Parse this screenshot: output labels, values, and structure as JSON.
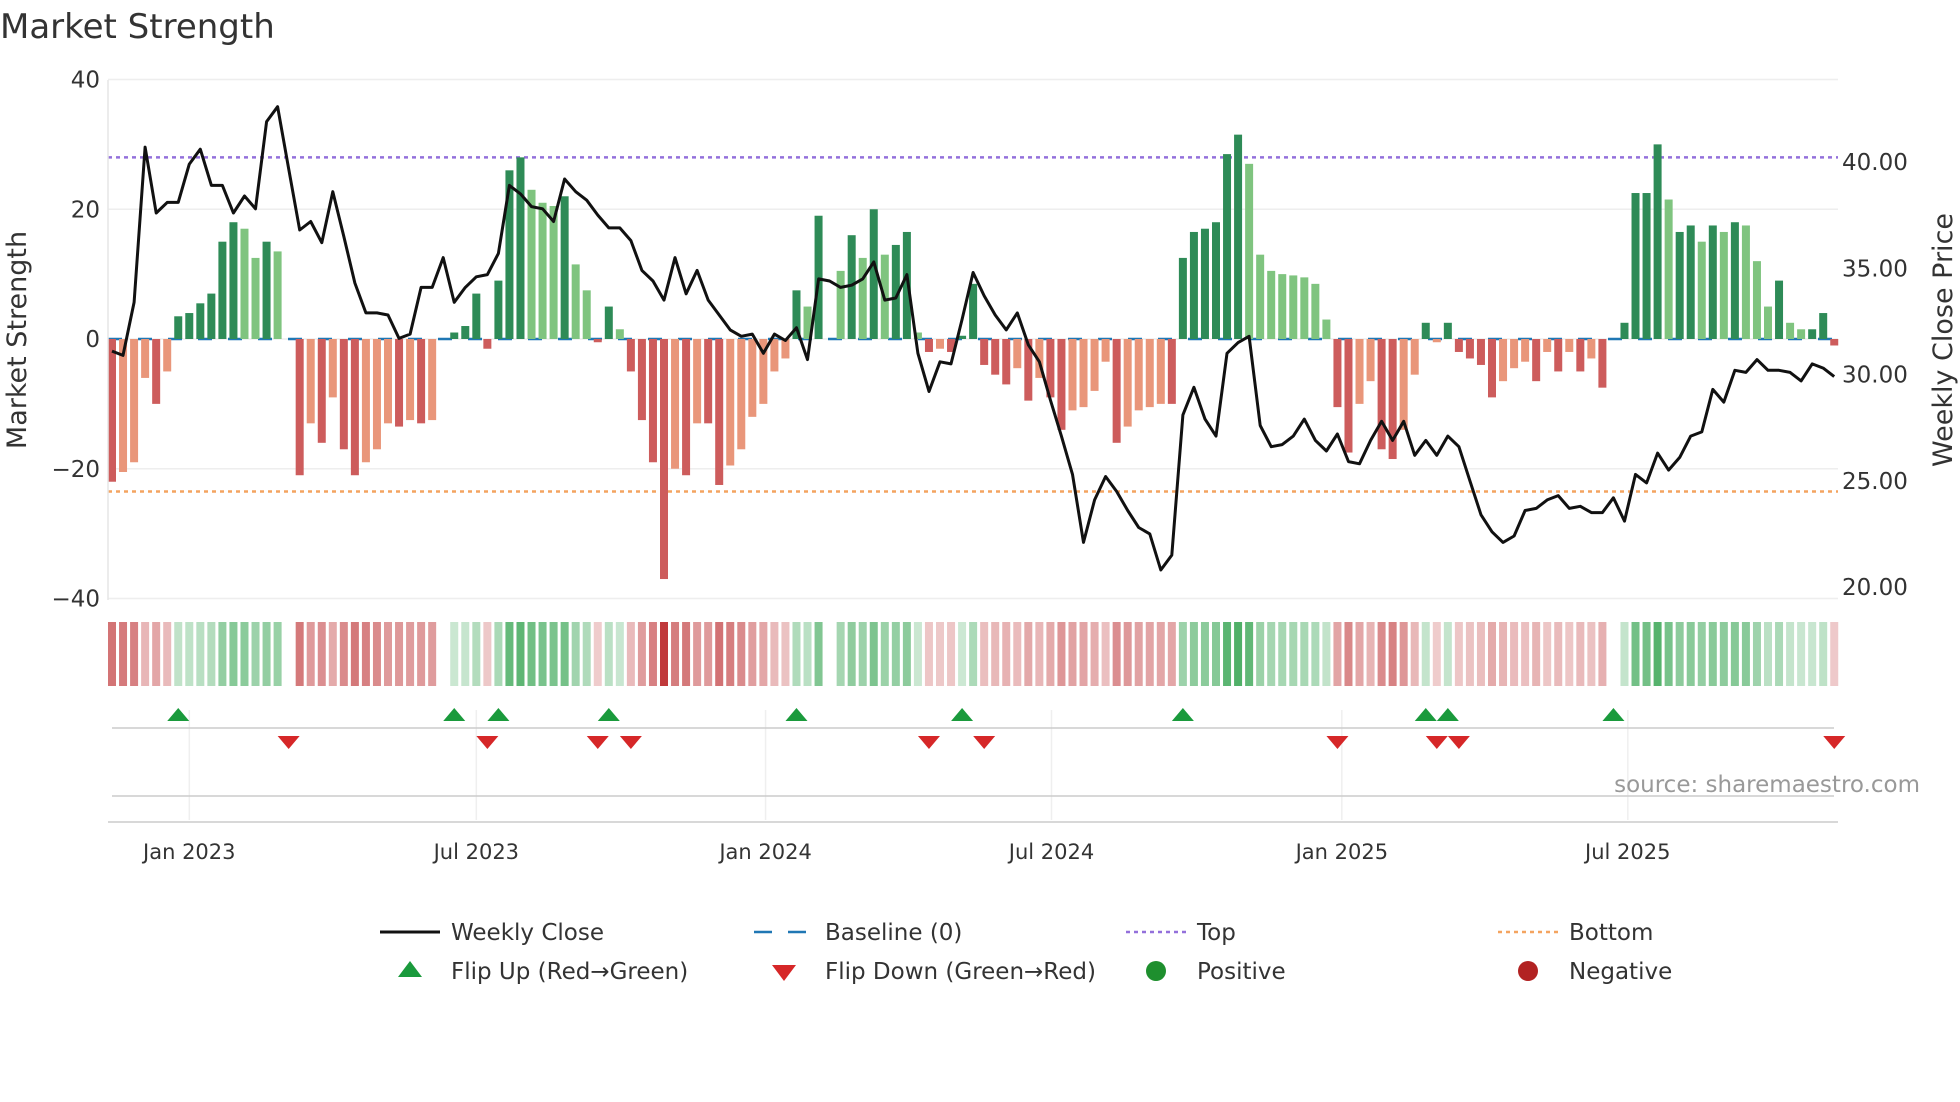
{
  "chart_data": {
    "type": "bar",
    "title": "Market Strength",
    "ylabel": "Market Strength",
    "y2label": "Weekly Close Price",
    "ylim": [
      -40,
      40
    ],
    "y2lim": [
      20,
      42.3
    ],
    "yticks": [
      "40",
      "20",
      "0",
      "−20",
      "−40"
    ],
    "ytick_values": [
      40,
      20,
      0,
      -20,
      -40
    ],
    "y2ticks": [
      "40.00",
      "35.00",
      "30.00",
      "25.00",
      "20.00"
    ],
    "y2tick_values": [
      40,
      35,
      30,
      25,
      20
    ],
    "xticks": [
      "Jan 2023",
      "Jul 2023",
      "Jan 2024",
      "Jul 2024",
      "Jan 2025",
      "Jul 2025"
    ],
    "xtick_week_index": [
      7.0,
      33.0,
      59.2,
      85.1,
      111.4,
      137.3
    ],
    "top_line": 28,
    "bottom_line": -23.5,
    "baseline": 0,
    "strength": [
      -22,
      -20.5,
      -19,
      -6,
      -10,
      -5,
      3.5,
      4,
      5.5,
      7,
      15,
      18,
      17,
      12.5,
      15,
      13.5,
      0,
      -21,
      -13,
      -16,
      -9,
      -17,
      -21,
      -19,
      -17,
      -13,
      -13.5,
      -12.5,
      -13,
      -12.5,
      0,
      1,
      2,
      7,
      -1.5,
      9,
      26,
      28,
      23,
      21,
      20.5,
      22,
      11.5,
      7.5,
      -0.5,
      5,
      1.5,
      -5,
      -12.5,
      -19,
      -37,
      -20,
      -21,
      -13,
      -13,
      -22.5,
      -19.5,
      -17,
      -12,
      -10,
      -5,
      -3,
      7.5,
      5,
      19,
      0,
      10.5,
      16,
      12.5,
      20,
      13,
      14.5,
      16.5,
      1,
      -2,
      -1.5,
      -2,
      0.5,
      8.5,
      -4,
      -5.5,
      -7,
      -4.5,
      -9.5,
      -6,
      -9,
      -14,
      -11,
      -10.5,
      -8,
      -3.5,
      -16,
      -13.5,
      -11,
      -10.5,
      -10,
      -10,
      12.5,
      16.5,
      17,
      18,
      28.5,
      31.5,
      27,
      13,
      10.5,
      10,
      9.8,
      9.5,
      8.5,
      3,
      -10.5,
      -17.5,
      -10,
      -6.5,
      -17,
      -18.5,
      -14,
      -5.5,
      2.5,
      -0.5,
      2.5,
      -2,
      -3,
      -4,
      -9,
      -6.5,
      -4.5,
      -3.5,
      -6.5,
      -2,
      -5,
      -2,
      -5,
      -3,
      -7.5,
      0,
      2.5,
      22.5,
      22.5,
      30,
      21.5,
      16.5,
      17.5,
      15,
      17.5,
      16.5,
      18,
      17.5,
      12,
      5,
      9,
      2.5,
      1.5,
      1.5,
      4,
      -1
    ],
    "strong": [
      1,
      0,
      0,
      0,
      1,
      0,
      1,
      1,
      1,
      1,
      1,
      1,
      0,
      0,
      1,
      0,
      0,
      1,
      0,
      1,
      0,
      1,
      1,
      0,
      0,
      0,
      1,
      0,
      1,
      0,
      0,
      1,
      1,
      1,
      1,
      1,
      1,
      1,
      0,
      0,
      0,
      1,
      0,
      0,
      1,
      1,
      0,
      1,
      1,
      1,
      1,
      0,
      1,
      0,
      1,
      1,
      0,
      0,
      0,
      0,
      0,
      0,
      1,
      0,
      1,
      0,
      0,
      1,
      0,
      1,
      0,
      1,
      1,
      0,
      1,
      0,
      1,
      1,
      1,
      1,
      1,
      1,
      0,
      1,
      0,
      1,
      1,
      0,
      0,
      0,
      0,
      1,
      0,
      0,
      0,
      0,
      1,
      1,
      1,
      1,
      1,
      1,
      1,
      0,
      0,
      0,
      0,
      0,
      0,
      0,
      0,
      1,
      1,
      0,
      0,
      1,
      1,
      0,
      0,
      1,
      0,
      1,
      1,
      1,
      1,
      1,
      0,
      0,
      0,
      1,
      0,
      1,
      0,
      1,
      0,
      1,
      0,
      1,
      1,
      1,
      1,
      0,
      1,
      1,
      0,
      1,
      0,
      1,
      0,
      0,
      0,
      1,
      0,
      0,
      1,
      1,
      1
    ],
    "weekly_close": [
      31.1,
      30.9,
      33.4,
      40.7,
      37.6,
      38.1,
      38.1,
      39.9,
      40.6,
      38.9,
      38.9,
      37.6,
      38.4,
      37.8,
      41.9,
      42.6,
      39.7,
      36.8,
      37.2,
      36.2,
      38.6,
      36.5,
      34.3,
      32.9,
      32.9,
      32.8,
      31.7,
      31.9,
      34.1,
      34.1,
      35.5,
      33.4,
      34.1,
      34.6,
      34.7,
      35.7,
      38.9,
      38.5,
      37.9,
      37.8,
      37.2,
      39.2,
      38.6,
      38.2,
      37.5,
      36.9,
      36.9,
      36.3,
      34.9,
      34.4,
      33.5,
      35.5,
      33.8,
      34.9,
      33.5,
      32.8,
      32.1,
      31.8,
      31.9,
      31.0,
      31.9,
      31.6,
      32.2,
      30.7,
      34.5,
      34.4,
      34.1,
      34.2,
      34.5,
      35.3,
      33.5,
      33.6,
      34.7,
      31.0,
      29.2,
      30.6,
      30.5,
      32.6,
      34.8,
      33.7,
      32.8,
      32.1,
      32.9,
      31.4,
      30.6,
      28.8,
      27.1,
      25.3,
      22.1,
      24.1,
      25.2,
      24.5,
      23.6,
      22.8,
      22.5,
      20.8,
      21.5,
      28.1,
      29.4,
      27.9,
      27.1,
      31.0,
      31.5,
      31.8,
      27.6,
      26.6,
      26.7,
      27.1,
      27.9,
      26.9,
      26.4,
      27.2,
      25.9,
      25.8,
      26.9,
      27.8,
      26.9,
      27.8,
      26.2,
      26.9,
      26.2,
      27.1,
      26.6,
      25.0,
      23.4,
      22.6,
      22.1,
      22.4,
      23.6,
      23.7,
      24.1,
      24.3,
      23.7,
      23.8,
      23.5,
      23.5,
      24.2,
      23.1,
      25.3,
      24.9,
      26.3,
      25.5,
      26.1,
      27.1,
      27.3,
      29.3,
      28.7,
      30.2,
      30.1,
      30.7,
      30.2,
      30.2,
      30.1,
      29.7,
      30.5,
      30.3,
      29.9
    ],
    "flip_up_index": [
      6,
      31,
      35,
      45,
      62,
      77,
      97,
      119,
      121,
      136
    ],
    "flip_down_index": [
      16,
      34,
      44,
      47,
      74,
      79,
      111,
      120,
      122,
      156
    ],
    "colors": {
      "pos_strong": "#2e8b57",
      "pos_weak": "#7fc47f",
      "neg_strong": "#cd5c5c",
      "neg_weak": "#e9967a",
      "line": "#111111",
      "baseline": "#1f77b4",
      "top": "#9370db",
      "bottom": "#f4a460",
      "flip_up": "#1a9a3c",
      "flip_down": "#d62728",
      "positive": "#1e8f2e",
      "negative": "#b22222"
    },
    "legend": [
      {
        "label": "Weekly Close",
        "kind": "line"
      },
      {
        "label": "Baseline (0)",
        "kind": "dash"
      },
      {
        "label": "Top",
        "kind": "dot-top"
      },
      {
        "label": "Bottom",
        "kind": "dot-bottom"
      },
      {
        "label": "Flip Up (Red→Green)",
        "kind": "tri-up"
      },
      {
        "label": "Flip Down (Green→Red)",
        "kind": "tri-down"
      },
      {
        "label": "Positive",
        "kind": "dot-pos"
      },
      {
        "label": "Negative",
        "kind": "dot-neg"
      }
    ],
    "legend_position": "bottom",
    "source": "source: sharemaestro.com"
  }
}
